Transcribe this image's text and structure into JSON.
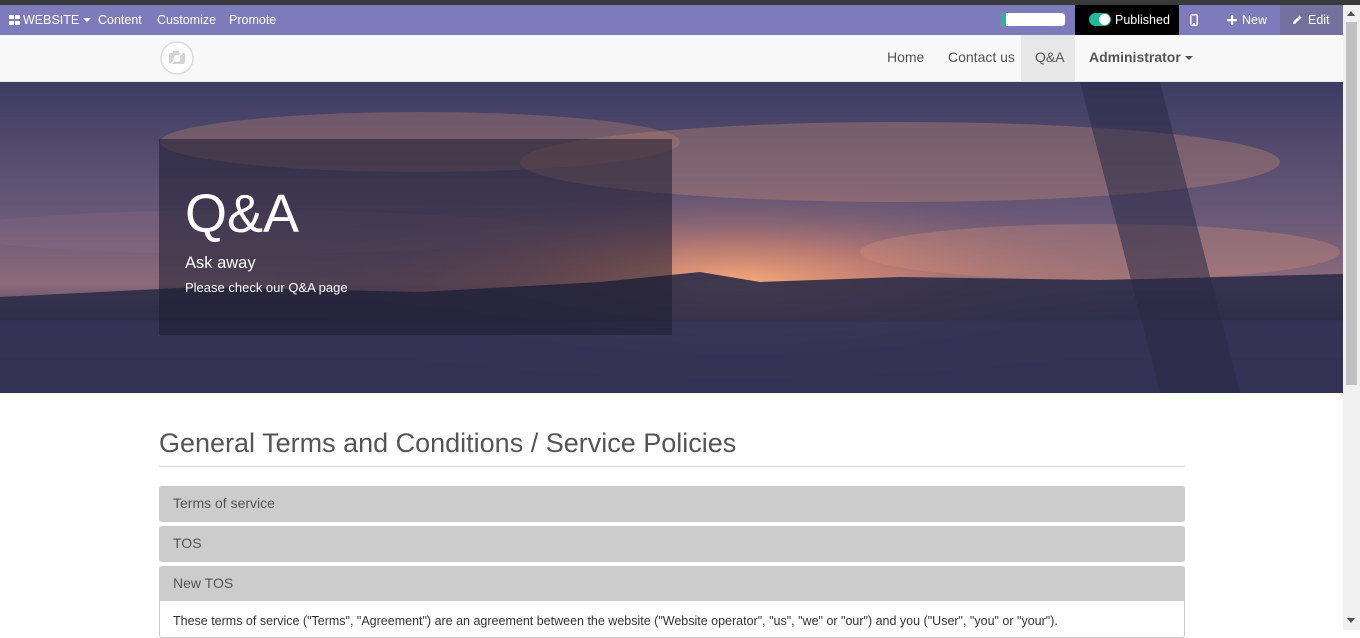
{
  "admin_bar": {
    "website_menu": "WEBSITE",
    "content": "Content",
    "customize": "Customize",
    "promote": "Promote",
    "progress": 0.08,
    "published": "Published",
    "new": "New",
    "edit": "Edit"
  },
  "navbar": {
    "links": [
      "Home",
      "Contact us",
      "Q&A"
    ],
    "active": "Q&A",
    "user_menu": "Administrator"
  },
  "hero": {
    "title": "Q&A",
    "subtitle": "Ask away",
    "text": "Please check our Q&A page"
  },
  "main": {
    "heading": "General Terms and Conditions / Service Policies",
    "panels": [
      {
        "title": "Terms of service"
      },
      {
        "title": "TOS"
      },
      {
        "title": "New TOS",
        "body": "These terms of service (\"Terms\", \"Agreement\") are an agreement between the website (\"Website operator\", \"us\", \"we\" or \"our\") and you (\"User\", \"you\" or \"your\")."
      }
    ]
  },
  "colors": {
    "admin_bar": "#7d7bbb",
    "accent": "#21b799",
    "published_bg": "#000000",
    "panel_heading": "#cccccc"
  },
  "icons": [
    "grid-icon",
    "caret-down-icon",
    "toggle-switch-icon",
    "mobile-icon",
    "plus-icon",
    "pencil-icon",
    "camera-logo-icon"
  ]
}
